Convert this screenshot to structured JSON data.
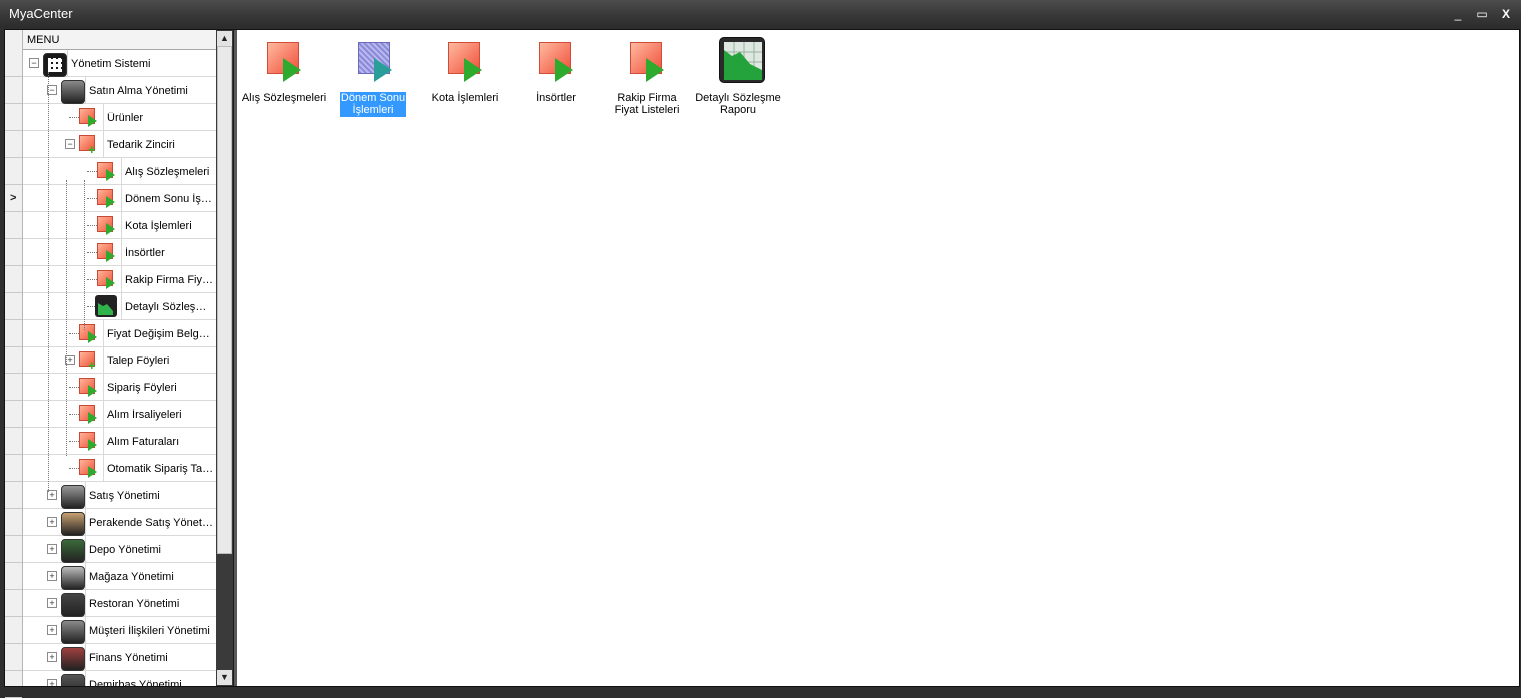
{
  "window": {
    "title": "MyaCenter",
    "minimize_glyph": "_",
    "maximize_glyph": "▭",
    "close_glyph": "X"
  },
  "menu": {
    "header": "MENU",
    "items": [
      {
        "label": "Yönetim Sistemi",
        "icon": "grid-app-icon"
      },
      {
        "label": "Satın Alma Yönetimi",
        "icon": "purchase-module-icon"
      },
      {
        "label": "Ürünler",
        "icon": "form-icon"
      },
      {
        "label": "Tedarik Zinciri",
        "icon": "folder-plus-icon"
      },
      {
        "label": "Alış Sözleşmeleri",
        "icon": "form-icon"
      },
      {
        "label": "Dönem Sonu İşlemleri",
        "icon": "form-icon"
      },
      {
        "label": "Kota İşlemleri",
        "icon": "form-icon"
      },
      {
        "label": "İnsörtler",
        "icon": "form-icon"
      },
      {
        "label": "Rakip Firma Fiyat Listeleri",
        "icon": "form-icon"
      },
      {
        "label": "Detaylı Sözleşme Raporu",
        "icon": "report-icon"
      },
      {
        "label": "Fiyat Değişim Belgeleri",
        "icon": "form-icon"
      },
      {
        "label": "Talep Föyleri",
        "icon": "folder-plus-icon"
      },
      {
        "label": "Sipariş Föyleri",
        "icon": "form-icon"
      },
      {
        "label": "Alım İrsaliyeleri",
        "icon": "form-icon"
      },
      {
        "label": "Alım Faturaları",
        "icon": "form-icon"
      },
      {
        "label": "Otomatik Sipariş Tavsiyesi",
        "icon": "form-icon"
      },
      {
        "label": "Satış Yönetimi",
        "icon": "sales-truck-icon"
      },
      {
        "label": "Perakende Satış Yönetimi",
        "icon": "barcode-icon"
      },
      {
        "label": "Depo Yönetimi",
        "icon": "warehouse-icon"
      },
      {
        "label": "Mağaza Yönetimi",
        "icon": "store-icon"
      },
      {
        "label": "Restoran Yönetimi",
        "icon": "restaurant-icon"
      },
      {
        "label": "Müşteri İlişkileri Yönetimi",
        "icon": "crm-icon"
      },
      {
        "label": "Finans Yönetimi",
        "icon": "finance-binders-icon"
      },
      {
        "label": "Demirbaş Yönetimi",
        "icon": "asset-icon"
      }
    ]
  },
  "content": {
    "tiles": [
      {
        "label": "Alış Sözleşmeleri",
        "icon": "form-play-icon",
        "selected": false
      },
      {
        "label": "Dönem Sonu İşlemleri",
        "icon": "form-play-icon",
        "selected": true
      },
      {
        "label": "Kota İşlemleri",
        "icon": "form-play-icon",
        "selected": false
      },
      {
        "label": "İnsörtler",
        "icon": "form-play-icon",
        "selected": false
      },
      {
        "label": "Rakip Firma Fiyat Listeleri",
        "icon": "form-play-icon",
        "selected": false
      },
      {
        "label": "Detaylı Sözleşme Raporu",
        "icon": "chart-report-icon",
        "selected": false
      }
    ]
  },
  "colors": {
    "titlebar": "#3a3a3a",
    "selection": "#3399ff",
    "form_icon": "#f0563a",
    "play_icon": "#2eaa2e"
  }
}
